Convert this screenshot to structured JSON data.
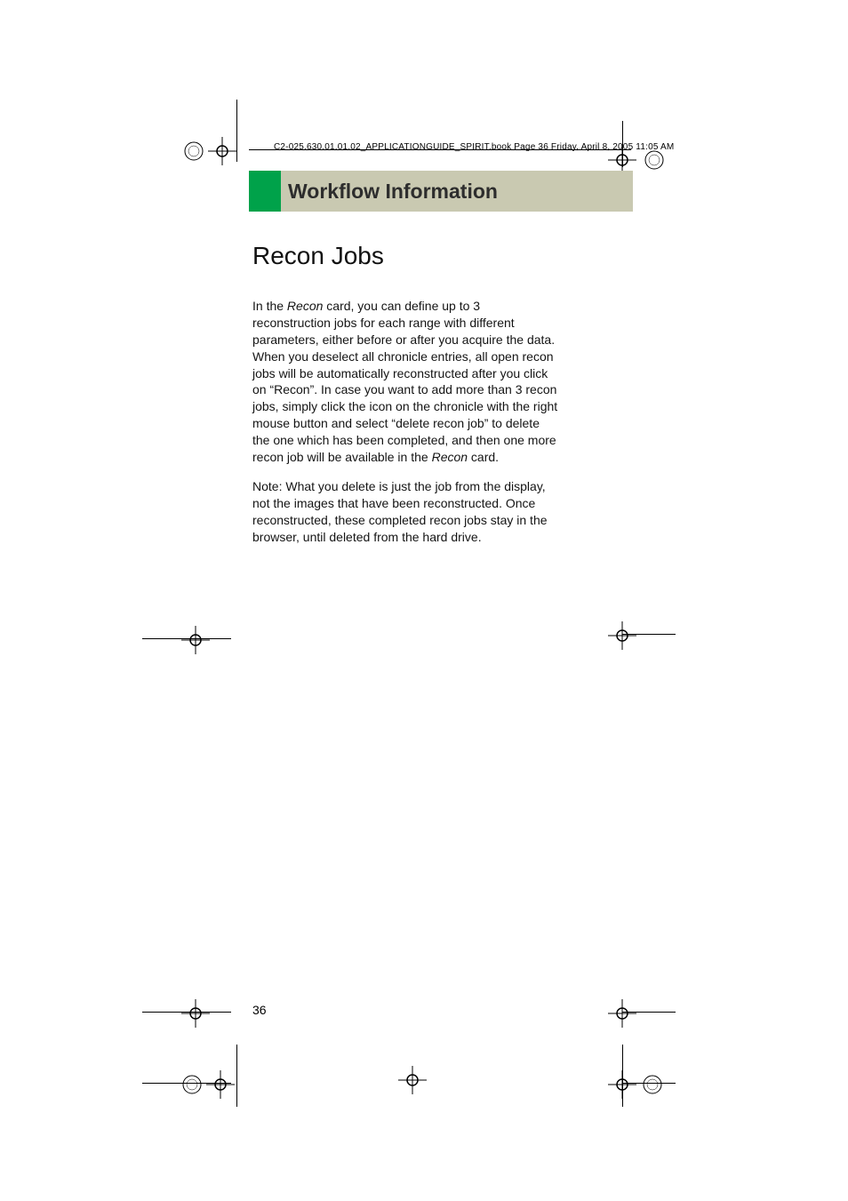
{
  "page_path_label": "C2-025.630.01.01.02_APPLICATIONGUIDE_SPIRIT.book  Page 36  Friday, April 8, 2005  11:05 AM",
  "chapter_title": "Workflow Information",
  "section_heading": "Recon Jobs",
  "body": {
    "p1_a": "In the ",
    "p1_em1": "Recon",
    "p1_b": " card, you can define up to 3 reconstruction jobs for each range with different parameters, either before or after you acquire the data. When you deselect all chronicle entries, all open recon jobs will be automatically reconstructed after you click on “Recon”. In case you want to add more than 3 recon jobs, simply click the icon on the chronicle with the right mouse button and select “delete recon job” to delete the one which has been completed, and then one more recon job will be available in the ",
    "p1_em2": "Recon",
    "p1_c": " card.",
    "p2": "Note: What you delete is just the job from the display, not the images that have been reconstructed. Once reconstructed, these completed recon jobs stay in the browser, until deleted from the hard drive."
  },
  "page_number": "36"
}
